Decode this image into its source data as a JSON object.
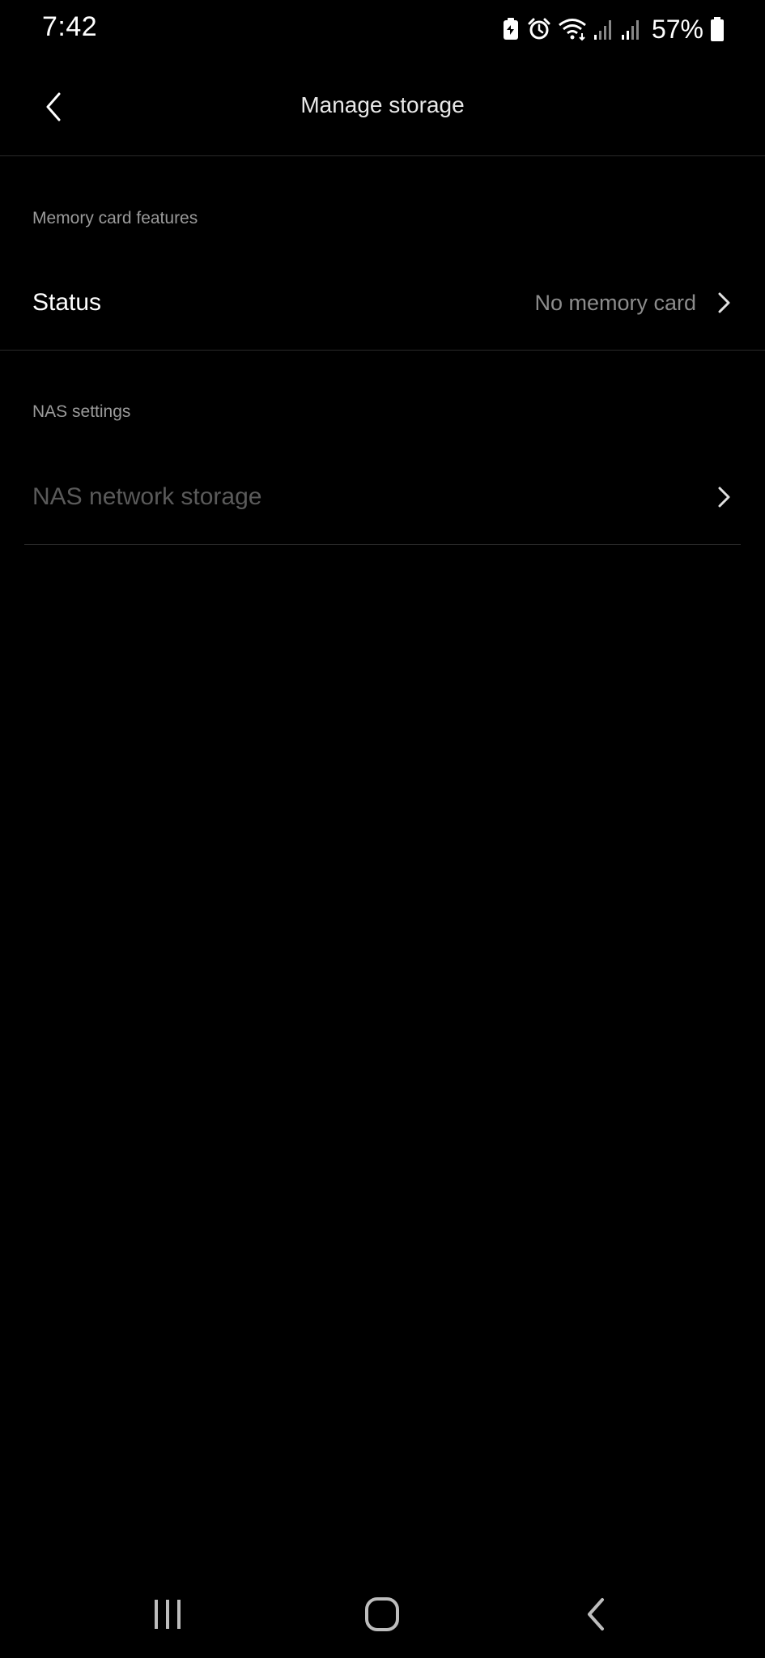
{
  "status_bar": {
    "time": "7:42",
    "battery": "57%",
    "icons": [
      "battery-saver-icon",
      "alarm-icon",
      "wifi-icon",
      "signal-icon",
      "signal-icon",
      "battery-icon"
    ]
  },
  "header": {
    "title": "Manage storage",
    "back_icon": "chevron-left-icon"
  },
  "sections": {
    "memory_card": {
      "label": "Memory card features",
      "status_row": {
        "title": "Status",
        "value": "No memory card"
      }
    },
    "nas": {
      "label": "NAS settings",
      "storage_row": {
        "title": "NAS network storage"
      }
    }
  },
  "nav_bar": {
    "icons": [
      "recents-icon",
      "home-icon",
      "back-icon"
    ]
  },
  "colors": {
    "background": "#000000",
    "text_primary": "#ffffff",
    "text_secondary": "#9a9a9a",
    "text_disabled": "#5a5a5a",
    "divider": "#2a2a2a"
  }
}
